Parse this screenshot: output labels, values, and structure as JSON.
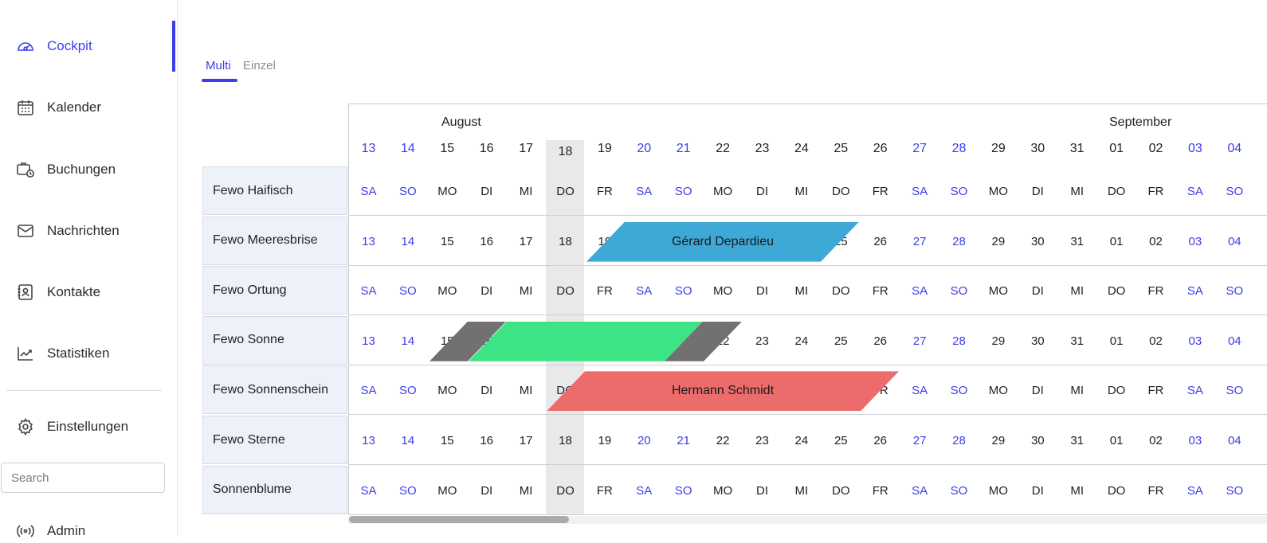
{
  "sidebar": {
    "items": [
      {
        "label": "Cockpit",
        "icon": "gauge-icon",
        "active": true
      },
      {
        "label": "Kalender",
        "icon": "calendar-icon"
      },
      {
        "label": "Buchungen",
        "icon": "briefcase-clock-icon"
      },
      {
        "label": "Nachrichten",
        "icon": "envelope-icon"
      },
      {
        "label": "Kontakte",
        "icon": "contact-card-icon"
      },
      {
        "label": "Statistiken",
        "icon": "chart-trend-icon"
      }
    ],
    "settings": {
      "label": "Einstellungen",
      "icon": "gear-icon"
    },
    "search_placeholder": "Search",
    "admin": {
      "label": "Admin",
      "icon": "broadcast-icon"
    }
  },
  "tabs": [
    {
      "label": "Multi",
      "active": true
    },
    {
      "label": "Einzel",
      "active": false
    }
  ],
  "calendar": {
    "months": [
      "August",
      "September"
    ],
    "days": [
      "13",
      "14",
      "15",
      "16",
      "17",
      "18",
      "19",
      "20",
      "21",
      "22",
      "23",
      "24",
      "25",
      "26",
      "27",
      "28",
      "29",
      "30",
      "31",
      "01",
      "02",
      "03",
      "04"
    ],
    "weekdays": [
      "SA",
      "SO",
      "MO",
      "DI",
      "MI",
      "DO",
      "FR",
      "SA",
      "SO",
      "MO",
      "DI",
      "MI",
      "DO",
      "FR",
      "SA",
      "SO",
      "MO",
      "DI",
      "MI",
      "DO",
      "FR",
      "SA",
      "SO"
    ],
    "weekend": [
      true,
      true,
      false,
      false,
      false,
      false,
      false,
      true,
      true,
      false,
      false,
      false,
      false,
      false,
      true,
      true,
      false,
      false,
      false,
      false,
      false,
      true,
      true
    ],
    "today": "18",
    "properties": [
      {
        "name": "Fewo Haifisch",
        "show": "weekdays"
      },
      {
        "name": "Fewo Meeresbrise",
        "show": "days"
      },
      {
        "name": "Fewo Ortung",
        "show": "weekdays"
      },
      {
        "name": "Fewo Sonne",
        "show": "days"
      },
      {
        "name": "Fewo Sonnenschein",
        "show": "weekdays"
      },
      {
        "name": "Fewo Sterne",
        "show": "days"
      },
      {
        "name": "Sonnenblume",
        "show": "weekdays"
      }
    ],
    "bookings": [
      {
        "guest": "Gérard Depardieu",
        "property": "Fewo Meeresbrise",
        "color": "#3ea8d6"
      },
      {
        "guest": "",
        "property": "Fewo Sonne",
        "color": "#717171",
        "kind": "blocked"
      },
      {
        "guest": "",
        "property": "Fewo Sonne",
        "color": "#3de486"
      },
      {
        "guest": "",
        "property": "Fewo Sonne",
        "color": "#717171",
        "kind": "blocked"
      },
      {
        "guest": "Hermann Schmidt",
        "property": "Fewo Sonnenschein",
        "color": "#ec6c6c"
      }
    ]
  },
  "colors": {
    "accent": "#3d3dea",
    "weekend_text": "#3d3dea",
    "today_column": "#e9e9e9",
    "row_label_bg": "#edf2fa"
  }
}
